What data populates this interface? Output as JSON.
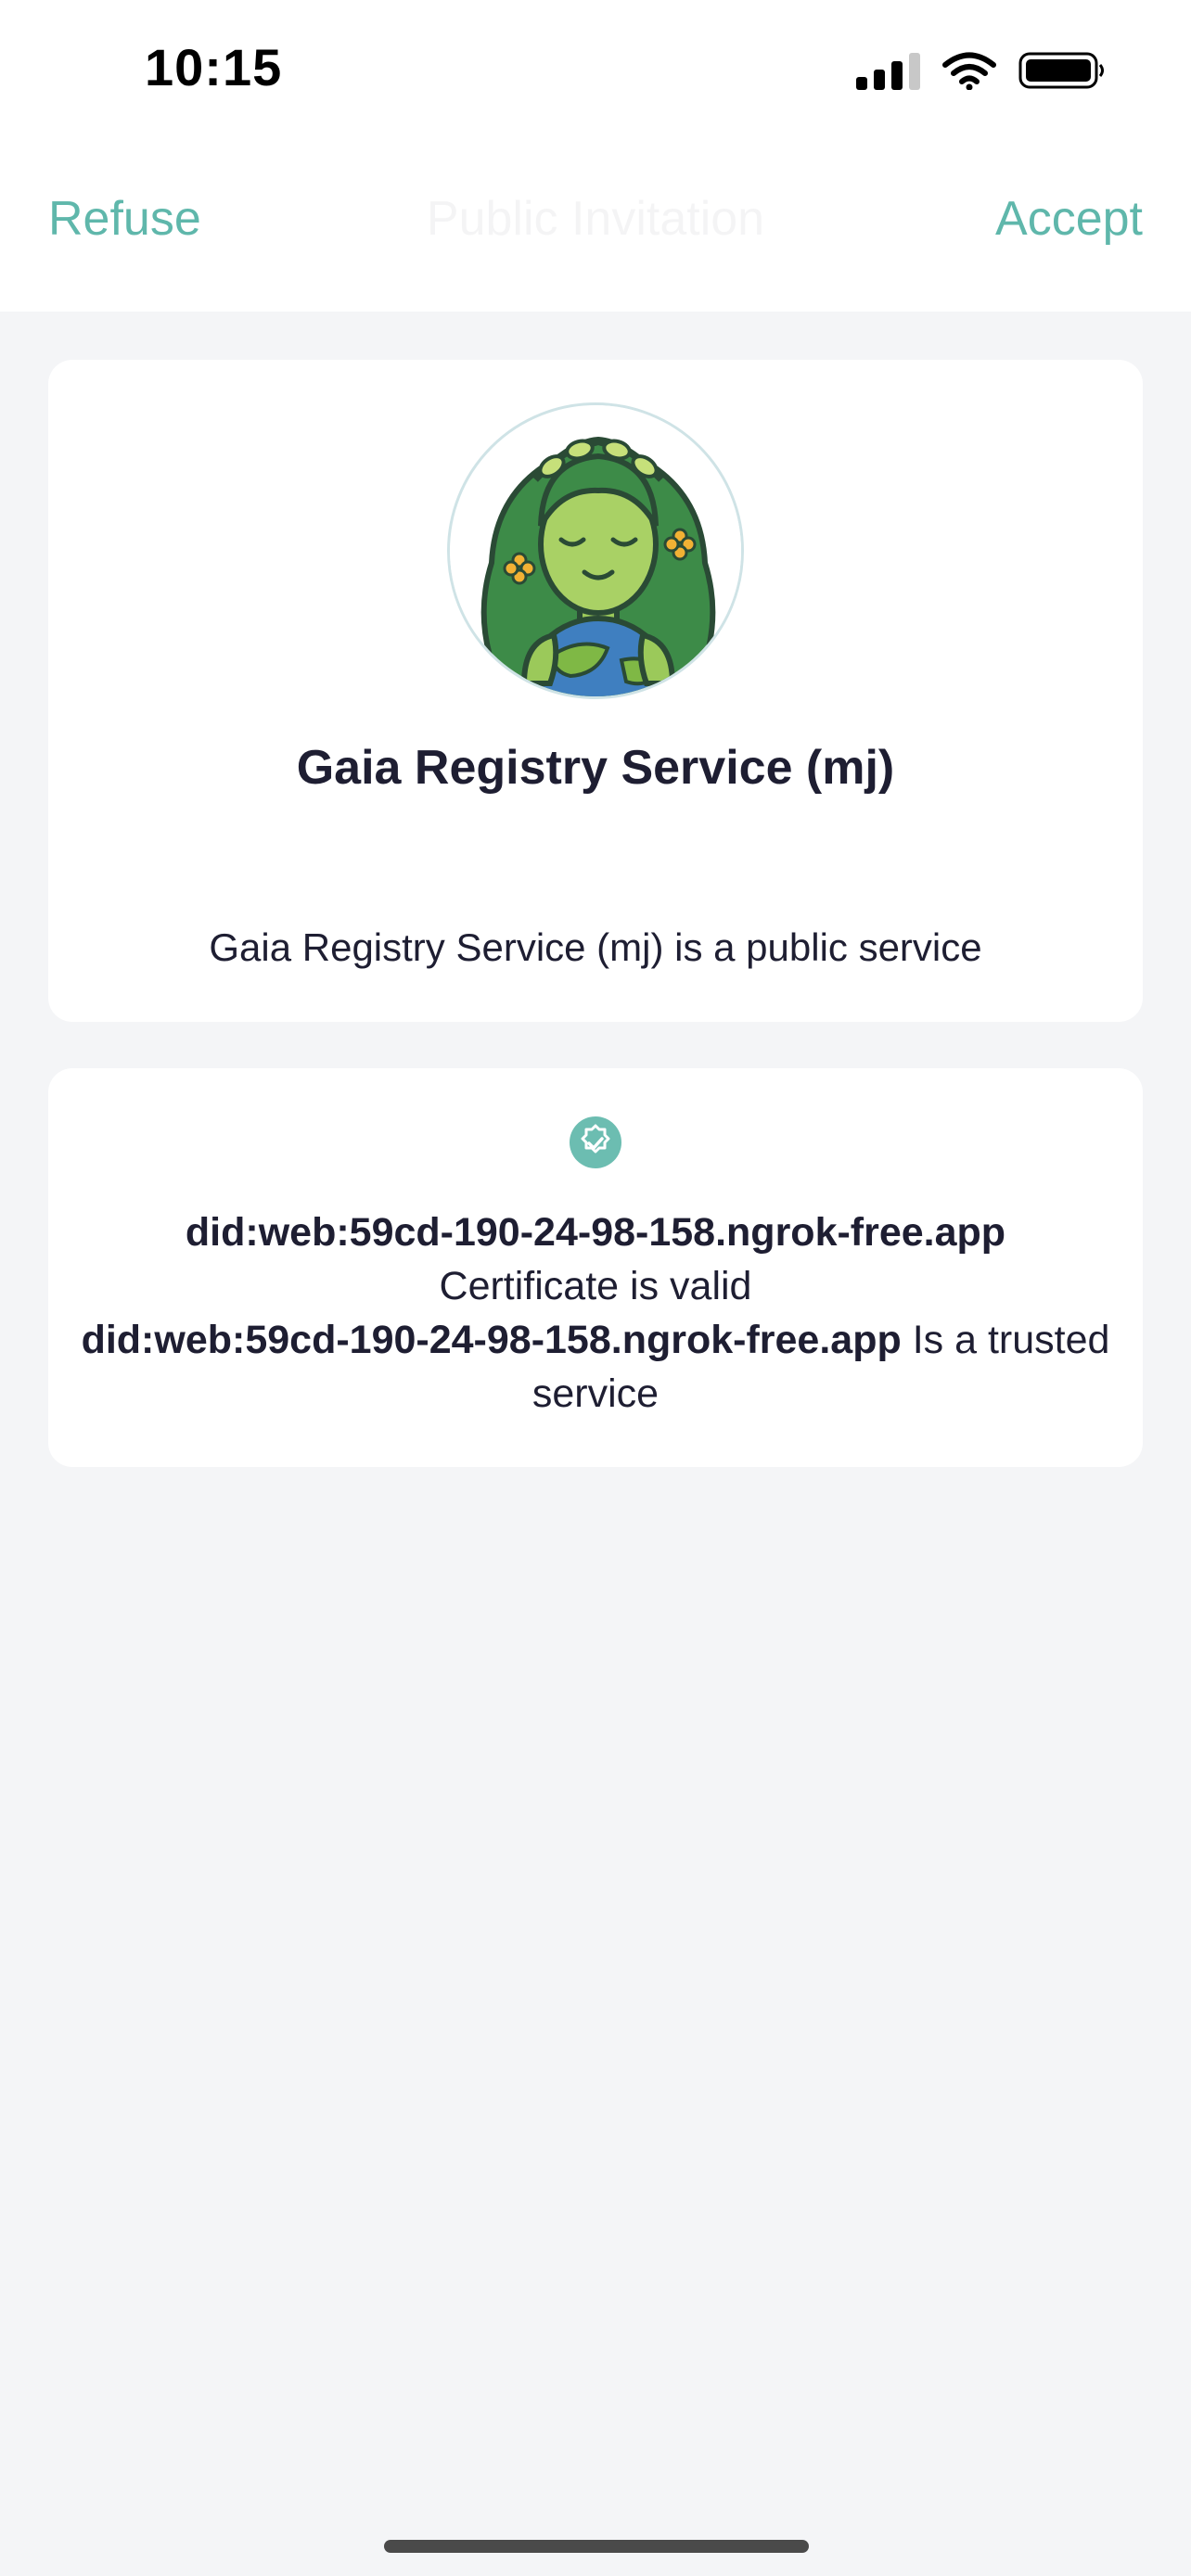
{
  "status_bar": {
    "time": "10:15"
  },
  "header": {
    "left_action": "Refuse",
    "title": "Public Invitation",
    "right_action": "Accept"
  },
  "service": {
    "name": "Gaia Registry Service (mj)",
    "description": "Gaia Registry Service (mj) is a public service"
  },
  "certificate": {
    "did": "did:web:59cd-190-24-98-158.ngrok-free.app",
    "status": "Certificate is valid",
    "trusted_did": "did:web:59cd-190-24-98-158.ngrok-free.app",
    "trusted_suffix": " Is a trusted service"
  },
  "colors": {
    "accent": "#5fb7ab",
    "background": "#f4f5f7",
    "card": "#ffffff",
    "text": "#1e1e32"
  },
  "icons": [
    "signal-icon",
    "wifi-icon",
    "battery-icon",
    "verified-badge-icon",
    "gaia-avatar"
  ]
}
